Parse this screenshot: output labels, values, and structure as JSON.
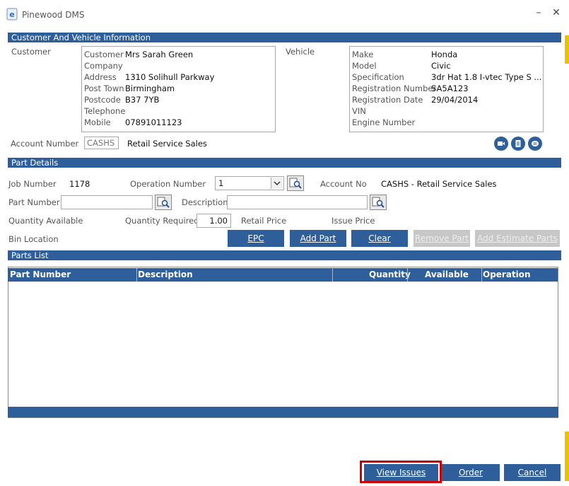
{
  "window": {
    "title": "Pinewood DMS",
    "minimize": "–",
    "close": "✕"
  },
  "customer_vehicle": {
    "section_title": "Customer And Vehicle Information",
    "customer_label": "Customer",
    "customer_fields": [
      {
        "label": "Customer",
        "value": "Mrs Sarah Green"
      },
      {
        "label": "Company",
        "value": ""
      },
      {
        "label": "Address",
        "value": "1310 Solihull Parkway"
      },
      {
        "label": "Post Town",
        "value": "Birmingham"
      },
      {
        "label": "Postcode",
        "value": "B37 7YB"
      },
      {
        "label": "Telephone",
        "value": ""
      },
      {
        "label": "Mobile",
        "value": "07891011123"
      }
    ],
    "vehicle_label": "Vehicle",
    "vehicle_fields": [
      {
        "label": "Make",
        "value": "Honda"
      },
      {
        "label": "Model",
        "value": "Civic"
      },
      {
        "label": "Specification",
        "value": "3dr Hat 1.8 I-vtec Type S ..."
      },
      {
        "label": "Registration Number",
        "value": "SA5A123"
      },
      {
        "label": "Registration Date",
        "value": "29/04/2014"
      },
      {
        "label": "VIN",
        "value": ""
      },
      {
        "label": "Engine Number",
        "value": ""
      }
    ],
    "account_number_label": "Account Number",
    "account_number_value": "CASHS",
    "account_name": "Retail Service Sales",
    "icons": [
      "video-icon",
      "document-icon",
      "chat-icon"
    ]
  },
  "part_details": {
    "section_title": "Part Details",
    "job_number_label": "Job Number",
    "job_number_value": "1178",
    "operation_number_label": "Operation Number",
    "operation_number_value": "1",
    "account_no_label": "Account No",
    "account_no_value": "CASHS - Retail Service Sales",
    "part_number_label": "Part Number",
    "part_number_value": "",
    "description_label": "Description",
    "description_value": "",
    "quantity_available_label": "Quantity Available",
    "quantity_required_label": "Quantity Required",
    "quantity_required_value": "1.00",
    "retail_price_label": "Retail Price",
    "issue_price_label": "Issue Price",
    "bin_location_label": "Bin Location",
    "buttons": {
      "epc": "EPC",
      "add_part": "Add Part",
      "clear": "Clear",
      "remove_part": "Remove Part",
      "add_estimate_parts": "Add Estimate Parts"
    }
  },
  "parts_list": {
    "section_title": "Parts List",
    "columns": [
      "Part Number",
      "Description",
      "Quantity",
      "Available",
      "Operation"
    ],
    "rows": []
  },
  "footer": {
    "view_issues": "View Issues",
    "order": "Order",
    "cancel": "Cancel",
    "highlight_color": "#d00000"
  },
  "colors": {
    "accent": "#2f5f9a",
    "background_strip": "#e8c400"
  }
}
